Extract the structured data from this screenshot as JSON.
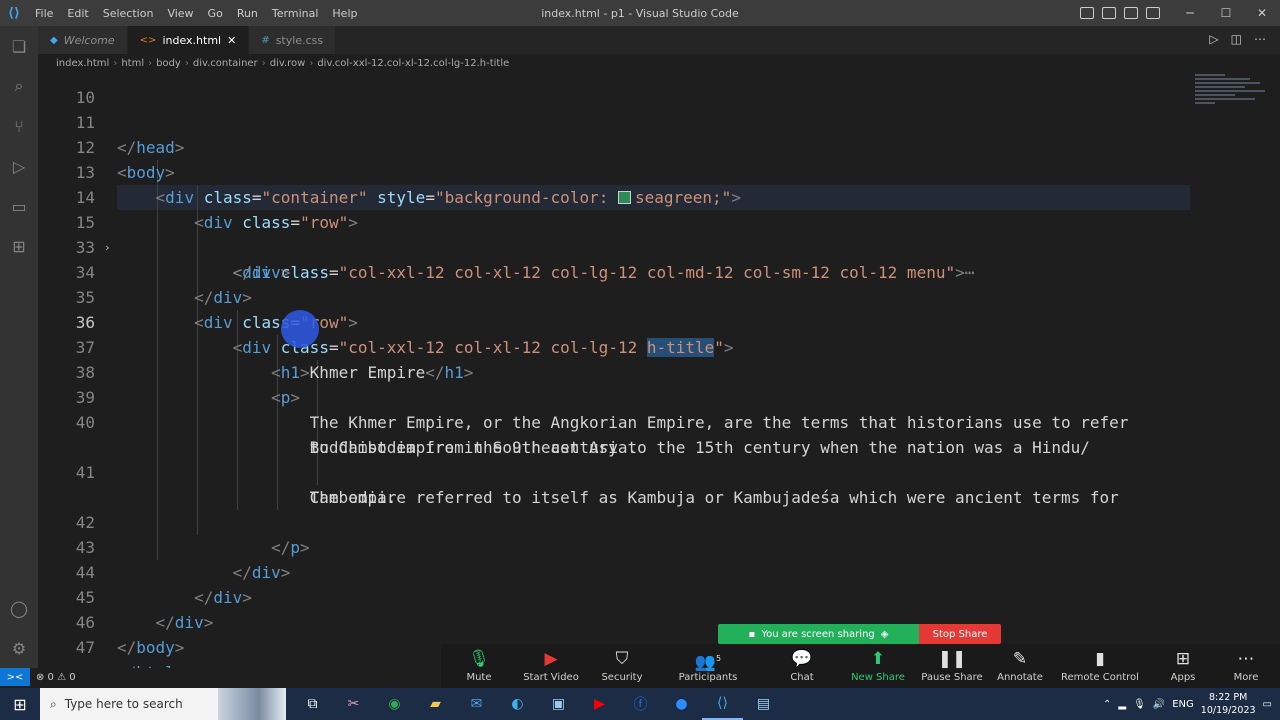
{
  "titlebar": {
    "menu": [
      "File",
      "Edit",
      "Selection",
      "View",
      "Go",
      "Run",
      "Terminal",
      "Help"
    ],
    "title": "index.html - p1 - Visual Studio Code"
  },
  "tabs": [
    {
      "label": "Welcome",
      "icon": "vscode-icon"
    },
    {
      "label": "index.html",
      "icon": "html-icon",
      "close": "✕"
    },
    {
      "label": "style.css",
      "icon": "css-icon"
    }
  ],
  "breadcrumb": [
    "index.html",
    "html",
    "body",
    "div.container",
    "div.row",
    "div.col-xxl-12.col-xl-12.col-lg-12.h-title"
  ],
  "editor": {
    "partial_line_number": "10",
    "current_line": "36",
    "line_numbers": [
      "11",
      "12",
      "13",
      "14",
      "15",
      "33",
      "34",
      "35",
      "36",
      "37",
      "38",
      "39",
      "40",
      "",
      "41",
      "",
      "42",
      "43",
      "44",
      "45",
      "46",
      "47"
    ],
    "code": {
      "l11_tag": "head",
      "l12_tag": "body",
      "l13_tag": "div",
      "l13_attr1": "class",
      "l13_val1": "\"container\"",
      "l13_attr2": "style",
      "l13_val2a": "\"background-color: ",
      "l13_val2b": "seagreen;\"",
      "l14_tag": "div",
      "l14_attr": "class",
      "l14_val": "\"row\"",
      "l15_tag": "div",
      "l15_attr": "class",
      "l15_val": "\"col-xxl-12 col-xl-12 col-lg-12 col-md-12 col-sm-12 col-12 menu\"",
      "l15_ellipsis": "⋯",
      "l33_tag": "div",
      "l34_tag": "div",
      "l35_tag": "div",
      "l35_attr": "class",
      "l35_val": "\"row\"",
      "l36_tag": "div",
      "l36_attr": "class",
      "l36_val_a": "\"col-xxl-12 col-xl-12 col-lg-12 ",
      "l36_val_sel": "h-title",
      "l36_val_b": "\"",
      "l37_tag": "h1",
      "l37_text": "Khmer Empire",
      "l38_tag": "p",
      "l39_text": "The Khmer Empire, or the Angkorian Empire, are the terms that historians use to refer",
      "l40_text_a": "to Cambodia from the 9th century to the 15th century when the nation was a Hindu/",
      "l40_text_b": "Buddhist empire in Southeast Asia.",
      "l41_text_a": "The empire referred to itself as Kambuja or Kambujadeśa which were ancient terms for",
      "l41_text_b": "Cambodia.",
      "l42_tag": "p",
      "l43_tag": "div",
      "l44_tag": "div",
      "l45_tag": "div",
      "l46_tag": "body",
      "l47_tag": "html"
    },
    "swatch_color": "#2e8b57"
  },
  "statusbar": {
    "remote": "><",
    "problems": "⊗ 0 ⚠ 0"
  },
  "zoom": {
    "banner": "You are screen sharing",
    "stop": "Stop Share",
    "participants_count": "5",
    "buttons": [
      "Mute",
      "Start Video",
      "Security",
      "Participants",
      "Chat",
      "New Share",
      "Pause Share",
      "Annotate",
      "Remote Control",
      "Apps",
      "More"
    ]
  },
  "taskbar": {
    "search_placeholder": "Type here to search",
    "language": "ENG",
    "time": "8:22 PM",
    "date": "10/19/2023"
  }
}
